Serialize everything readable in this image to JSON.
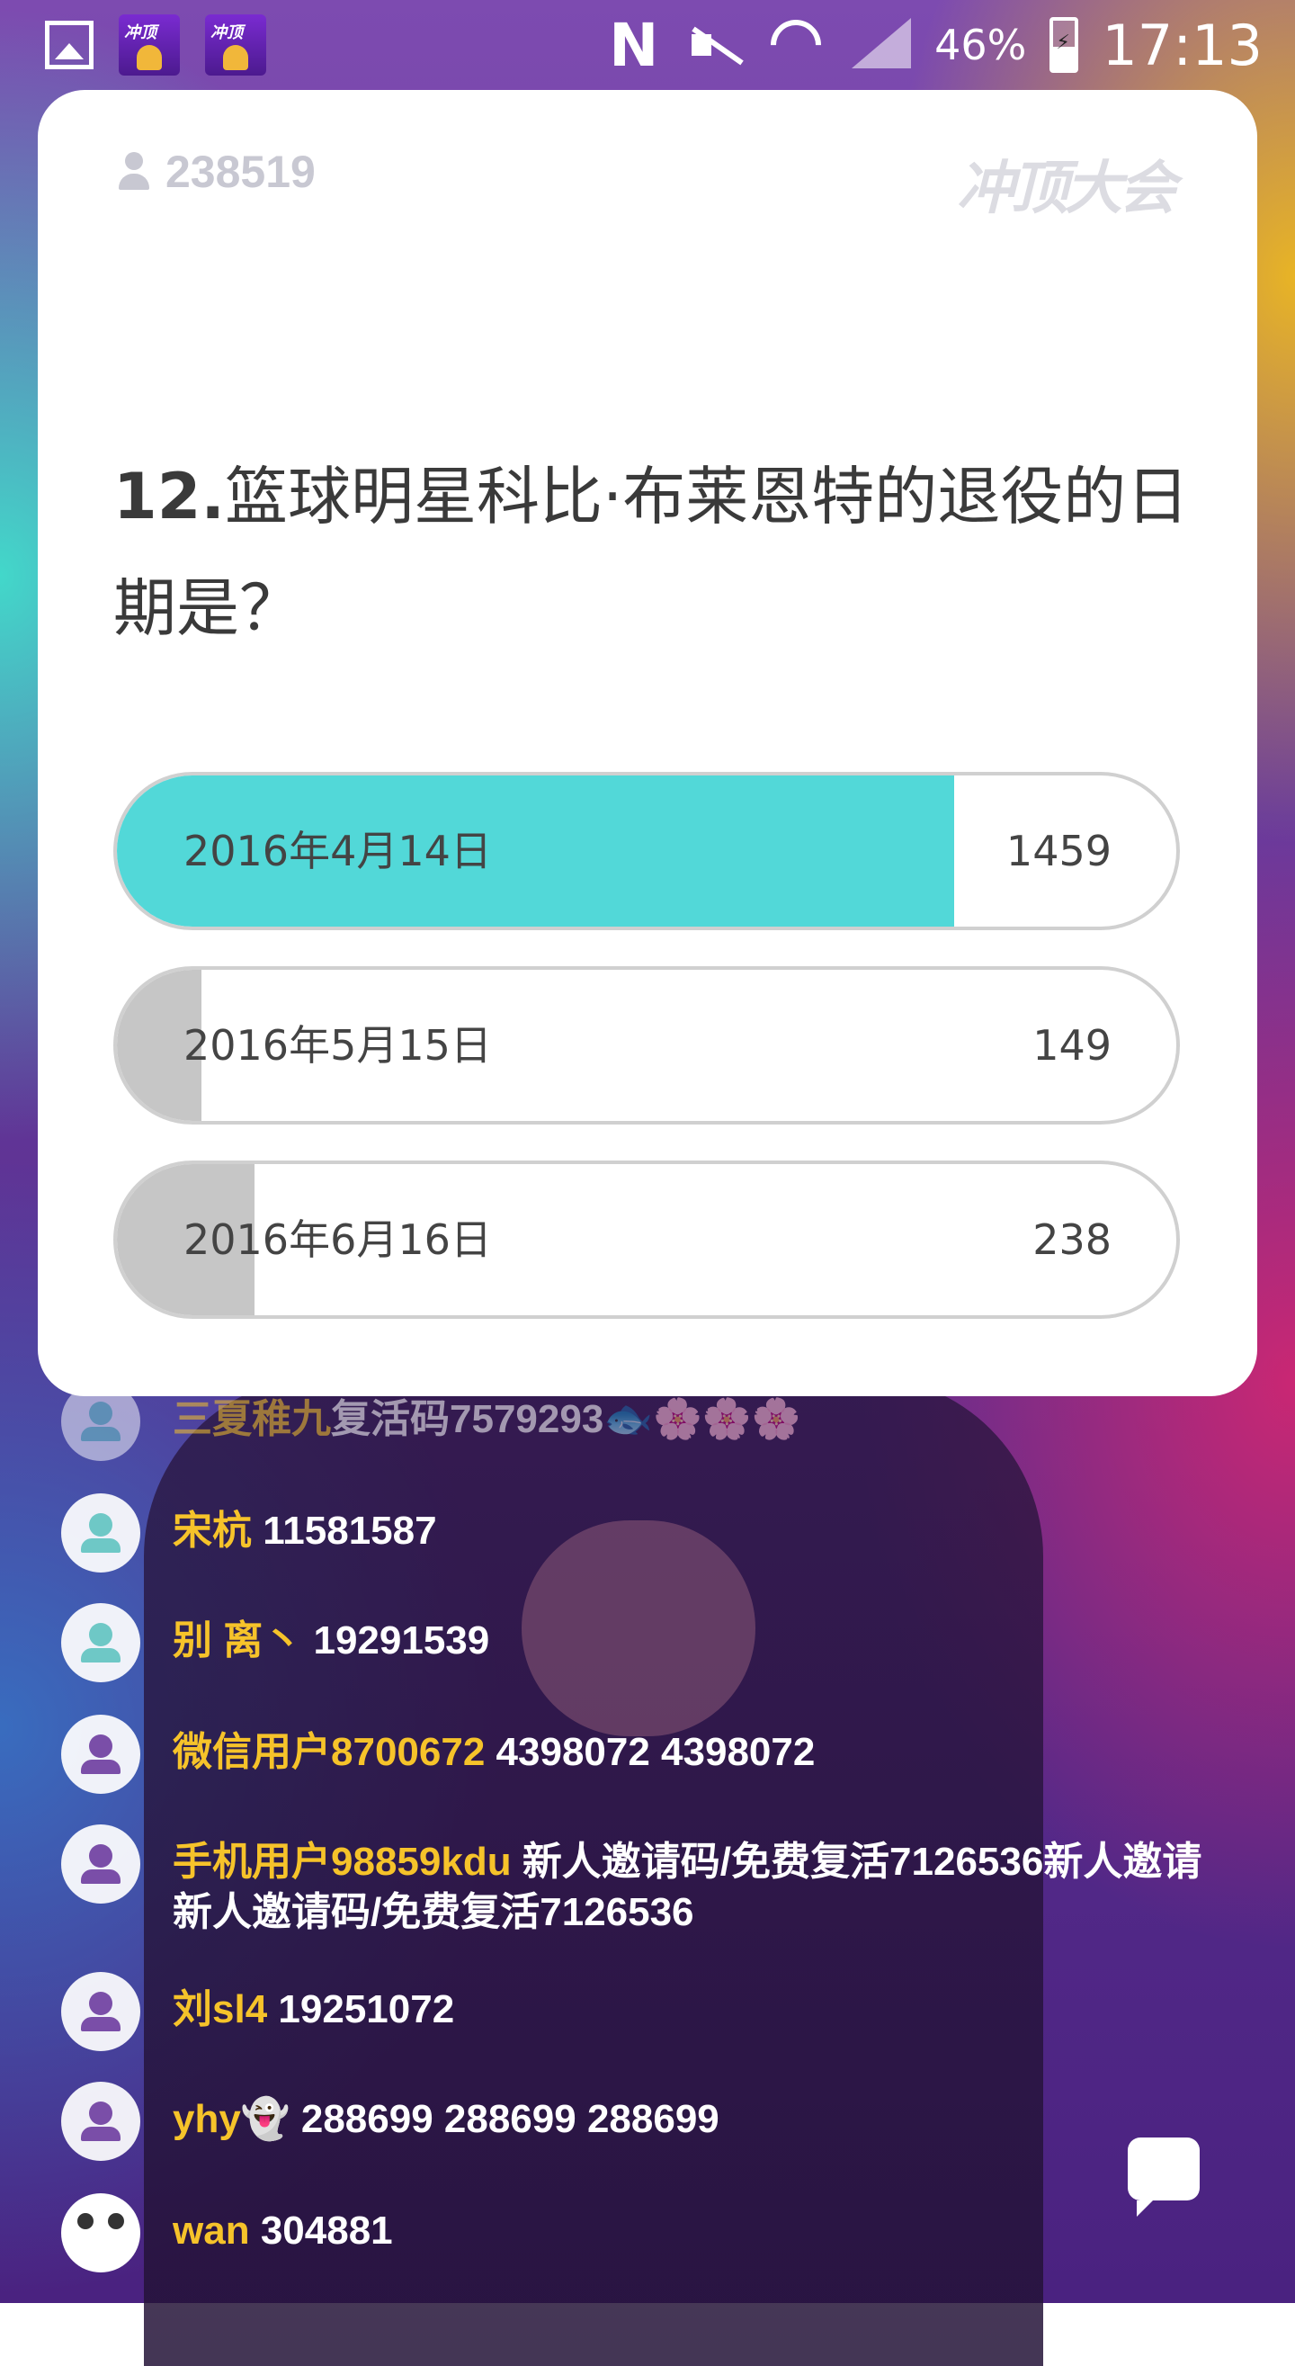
{
  "status_bar": {
    "battery_percent": "46%",
    "time": "17:13",
    "app_icon_text": "冲顶"
  },
  "card": {
    "viewer_count": "238519",
    "logo_text": "冲顶大会",
    "question_number": "12.",
    "question_text": "篮球明星科比·布莱恩特的退役的日期是？",
    "options": [
      {
        "label": "2016年4月14日",
        "count": "1459",
        "fill_percent": 79,
        "fill_color": "#52d8d8"
      },
      {
        "label": "2016年5月15日",
        "count": "149",
        "fill_percent": 8,
        "fill_color": "#c6c6c6"
      },
      {
        "label": "2016年6月16日",
        "count": "238",
        "fill_percent": 13,
        "fill_color": "#c6c6c6"
      }
    ]
  },
  "chat": {
    "messages": [
      {
        "name": "三夏稚九",
        "text": "复活码7579293🐟🌸🌸🌸",
        "avatar": "person-teal"
      },
      {
        "name": "宋杭",
        "text": "11581587",
        "avatar": "person-teal"
      },
      {
        "name": "别 离丶",
        "text": "19291539",
        "avatar": "person-teal"
      },
      {
        "name": "微信用户8700672",
        "text": "4398072  4398072",
        "avatar": "person-purple"
      },
      {
        "name": "手机用户98859kdu",
        "text": "新人邀请码/免费复活7126536新人邀请新人邀请码/免费复活7126536",
        "avatar": "person-purple"
      },
      {
        "name": "刘sl4",
        "text": "19251072",
        "avatar": "person-purple"
      },
      {
        "name": "yhy👻",
        "text": "288699    288699    288699",
        "avatar": "person-purple"
      },
      {
        "name": "wan",
        "text": "304881",
        "avatar": "panda"
      }
    ]
  }
}
